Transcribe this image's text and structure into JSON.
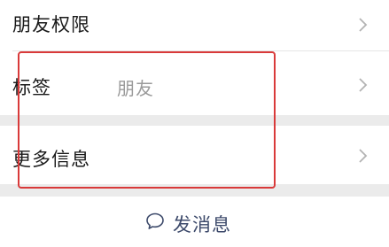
{
  "rows": [
    {
      "label": "朋友权限",
      "value": ""
    },
    {
      "label": "标签",
      "value": "朋友"
    },
    {
      "label": "更多信息",
      "value": ""
    }
  ],
  "send_message": {
    "label": "发消息",
    "icon": "chat-bubble-icon"
  },
  "colors": {
    "annotation": "#d93a3a",
    "send_text": "#3d4a6b",
    "separator": "#ebebeb"
  }
}
